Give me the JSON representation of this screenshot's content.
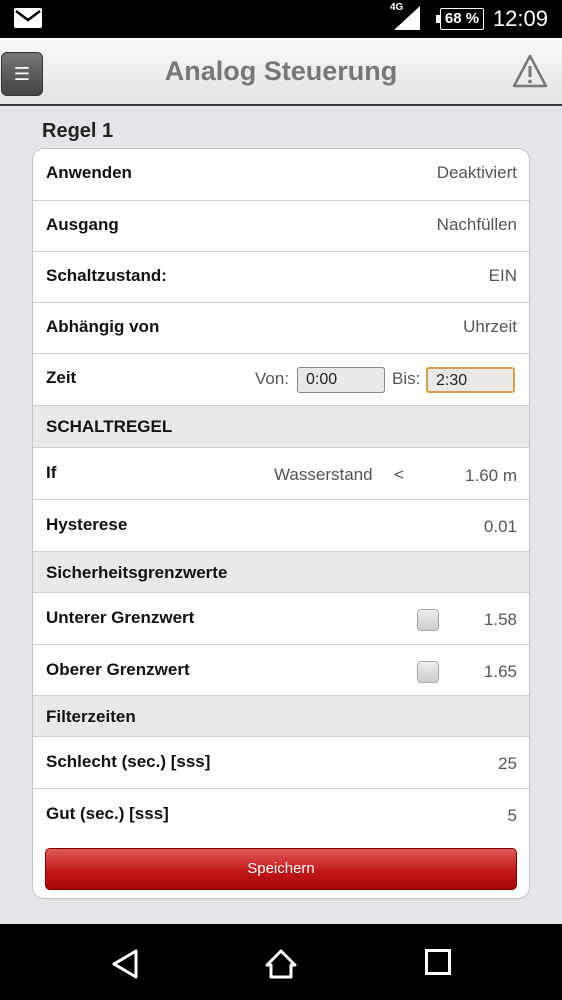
{
  "status_bar": {
    "network": "4G",
    "battery": "68 %",
    "time": "12:09",
    "icons": [
      "mail-icon",
      "signal-icon",
      "battery-icon"
    ]
  },
  "header": {
    "menu_icon": "☰",
    "title": "Analog Steuerung",
    "warning_icon": "warning-icon"
  },
  "section": {
    "title": "Regel 1"
  },
  "rows": {
    "anwenden": {
      "label": "Anwenden",
      "value": "Deaktiviert"
    },
    "ausgang": {
      "label": "Ausgang",
      "value": "Nachfüllen"
    },
    "schaltzustand": {
      "label": "Schaltzustand:",
      "value": "EIN"
    },
    "abhaengig": {
      "label": "Abhängig von",
      "value": "Uhrzeit"
    },
    "zeit": {
      "label": "Zeit",
      "von_label": "Von:",
      "von_value": "0:00",
      "bis_label": "Bis:",
      "bis_value": "2:30"
    },
    "schaltregel": {
      "label": "SCHALTREGEL"
    },
    "if_row": {
      "label": "If",
      "sensor": "Wasserstand",
      "operator": "<",
      "value": "1.60 m"
    },
    "hysterese": {
      "label": "Hysterese",
      "value": "0.01"
    },
    "sicherheit": {
      "label": "Sicherheitsgrenzwerte"
    },
    "unterer": {
      "label": "Unterer Grenzwert",
      "value": "1.58",
      "checked": false
    },
    "oberer": {
      "label": "Oberer Grenzwert",
      "value": "1.65",
      "checked": false
    },
    "filterzeiten": {
      "label": "Filterzeiten"
    },
    "schlecht": {
      "label": "Schlecht (sec.) [sss]",
      "value": "25"
    },
    "gut": {
      "label": "Gut (sec.) [sss]",
      "value": "5"
    }
  },
  "save_button": {
    "label": "Speichern"
  },
  "nav": {
    "icons": [
      "back-icon",
      "home-icon",
      "recents-icon"
    ]
  },
  "colors": {
    "accent_red": "#c21818",
    "header_text": "#777777",
    "focus_border": "#d8a040"
  }
}
